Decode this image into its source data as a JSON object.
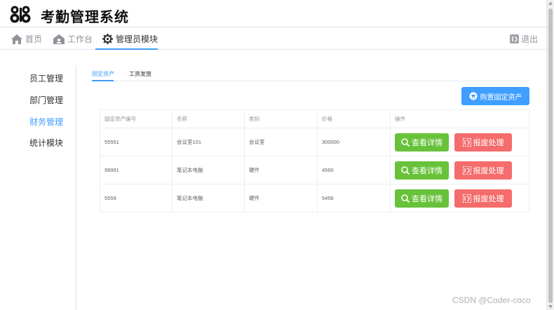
{
  "app": {
    "title": "考勤管理系统"
  },
  "nav": {
    "items": [
      {
        "label": "首页",
        "icon": "home-icon"
      },
      {
        "label": "工作台",
        "icon": "workbench-icon"
      },
      {
        "label": "管理员模块",
        "icon": "gear-icon"
      }
    ],
    "active_index": 2,
    "logout_label": "退出"
  },
  "sidebar": {
    "items": [
      {
        "label": "员工管理"
      },
      {
        "label": "部门管理"
      },
      {
        "label": "财务管理"
      },
      {
        "label": "统计模块"
      }
    ],
    "active_index": 2
  },
  "tabs": [
    {
      "label": "固定资产"
    },
    {
      "label": "工资发放"
    }
  ],
  "toolbar": {
    "buy_label": "购置固定资产"
  },
  "table": {
    "columns": [
      "固定资产编号",
      "名称",
      "类别",
      "价格",
      "操作"
    ],
    "rows": [
      {
        "id": "55551",
        "name": "会议室101",
        "category": "会议室",
        "price": "300000"
      },
      {
        "id": "99991",
        "name": "笔记本电脑",
        "category": "硬件",
        "price": "4560"
      },
      {
        "id": "5559",
        "name": "笔记本电脑",
        "category": "硬件",
        "price": "5456"
      }
    ],
    "view_label": "查看详情",
    "scrap_label": "报废处理"
  },
  "watermark": "CSDN @Coder-coco",
  "colors": {
    "primary": "#409eff",
    "success": "#67c23a",
    "danger": "#f56c6c"
  }
}
